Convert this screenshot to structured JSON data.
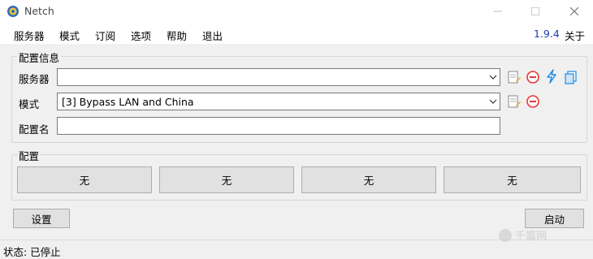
{
  "window": {
    "title": "Netch"
  },
  "menu": {
    "items": [
      "服务器",
      "模式",
      "订阅",
      "选项",
      "帮助",
      "退出"
    ],
    "version": "1.9.4",
    "about": "关于"
  },
  "config_info": {
    "title": "配置信息",
    "server_label": "服务器",
    "server_value": "",
    "mode_label": "模式",
    "mode_value": "[3] Bypass LAN and China",
    "profile_name_label": "配置名",
    "profile_name_value": ""
  },
  "profiles": {
    "title": "配置",
    "buttons": [
      "无",
      "无",
      "无",
      "无"
    ]
  },
  "actions": {
    "settings": "设置",
    "start": "启动"
  },
  "status": {
    "text": "状态: 已停止"
  },
  "watermark": {
    "text": "千篇网"
  },
  "icons": {
    "server_row": [
      "edit-icon",
      "remove-icon",
      "lightning-icon",
      "copy-icon"
    ],
    "mode_row": [
      "edit-icon",
      "remove-icon"
    ]
  },
  "colors": {
    "version": "#1a3fb0",
    "remove": "#e53935",
    "lightning": "#1e88e5"
  }
}
